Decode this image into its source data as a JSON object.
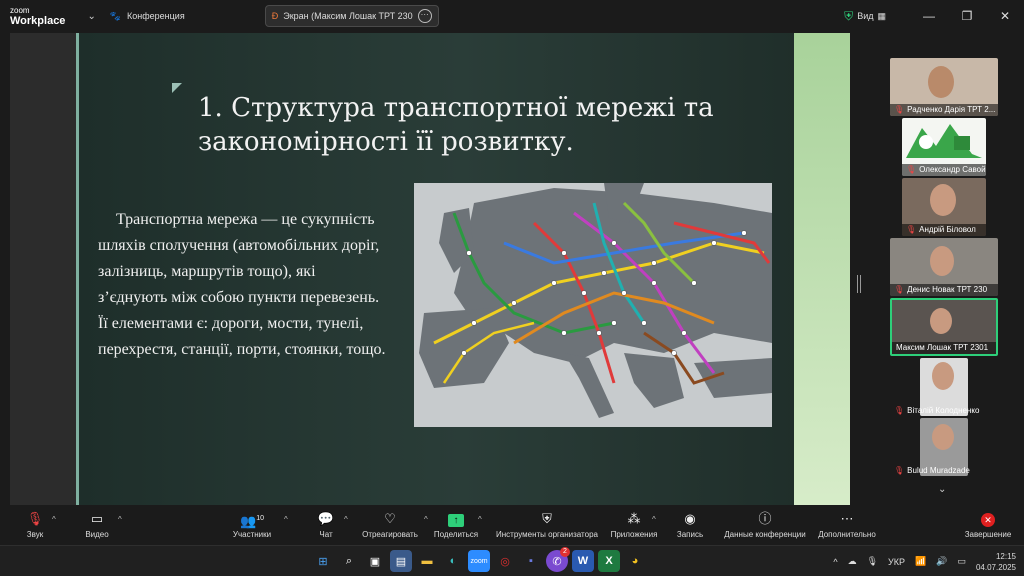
{
  "titlebar": {
    "logo_line1": "zoom",
    "logo_line2": "Workplace",
    "conference_label": "Конференция",
    "share_label": "Экран (Максим Лошак ТРТ 230",
    "view_label": "Вид",
    "minimize": "—",
    "maximize": "❐",
    "close": "✕"
  },
  "slide": {
    "title": "1. Структура транспортної мережі та закономірності її розвитку.",
    "body": "Транспортна мережа — це сукупність шляхів сполучення (автомобільних доріг, залізниць, маршрутів тощо), які з’єднують між собою пункти перевезень. Її елементами є: дороги, мости, тунелі, перехрестя, станції, порти, стоянки, тощо."
  },
  "participants": [
    {
      "name": "Радченко Дарія ТРТ 2...",
      "muted": true
    },
    {
      "name": "Олександр Савойськи...",
      "muted": true
    },
    {
      "name": "Андрій Біловол",
      "muted": true
    },
    {
      "name": "Денис Новак ТРТ 230",
      "muted": true
    },
    {
      "name": "Максим Лошак ТРТ 2301",
      "muted": false
    },
    {
      "name": "Віталій Колодненко",
      "muted": true
    },
    {
      "name": "Bulud Muradzade",
      "muted": true
    }
  ],
  "toolbar": {
    "audio": "Звук",
    "video": "Видео",
    "participants": "Участники",
    "participants_count": "10",
    "chat": "Чат",
    "react": "Отреагировать",
    "share": "Поделиться",
    "host_tools": "Инструменты организатора",
    "apps": "Приложения",
    "record": "Запись",
    "info": "Данные конференции",
    "more": "Дополнительно",
    "end": "Завершение"
  },
  "taskbar": {
    "language": "УКР",
    "time": "12:15",
    "date": "04.07.2025",
    "viber_badge": "2"
  },
  "colors": {
    "active_speaker": "#2ecf7a",
    "end_button": "#e02020",
    "slide_bg": "#24352f"
  }
}
